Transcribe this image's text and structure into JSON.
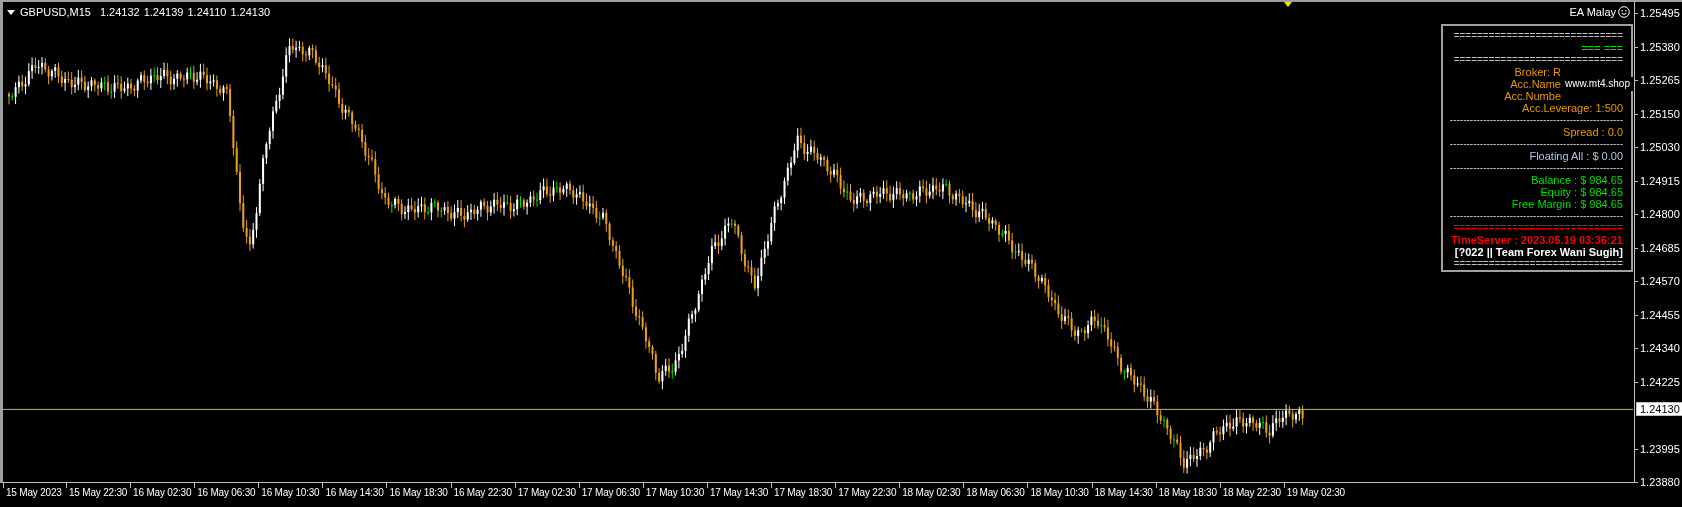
{
  "header": {
    "symbol": "GBPUSD,M15",
    "quotes": [
      "1.24132",
      "1.24139",
      "1.24110",
      "1.24130"
    ]
  },
  "ea_label": "EA Malay",
  "panel": {
    "lines": [
      {
        "kind": "rule",
        "text": "=============================",
        "color": "#c0c0c0"
      },
      {
        "kind": "line",
        "text": "=== ===",
        "color": "#00e000"
      },
      {
        "kind": "rule",
        "text": "=============================",
        "color": "#c0c0c0"
      },
      {
        "kind": "account",
        "text": "Broker: R",
        "color": "#e89a00"
      },
      {
        "kind": "account",
        "text": "Acc.Name",
        "color": "#e89a00"
      },
      {
        "kind": "account",
        "text": "Acc.Numbe",
        "color": "#e89a00"
      },
      {
        "kind": "line",
        "text": "Acc.Leverage: 1:500",
        "color": "#e89a00"
      },
      {
        "kind": "dash",
        "text": "----------------------------------------------------"
      },
      {
        "kind": "line",
        "text": "Spread :  0.0",
        "color": "#e89a00"
      },
      {
        "kind": "dash",
        "text": "----------------------------------------------------"
      },
      {
        "kind": "line",
        "text": "Floating All  : $ 0.00",
        "color": "#b0c4de"
      },
      {
        "kind": "dash",
        "text": "----------------------------------------------------"
      },
      {
        "kind": "line",
        "text": "Balance  : $ 984.65",
        "color": "#00e000"
      },
      {
        "kind": "line",
        "text": "Equity  : $ 984.65",
        "color": "#00e000"
      },
      {
        "kind": "line",
        "text": "Free Margin : $ 984.65",
        "color": "#00e000"
      },
      {
        "kind": "dash",
        "text": "----------------------------------------------------"
      },
      {
        "kind": "rule",
        "text": "=============================",
        "color": "#ff0000"
      },
      {
        "kind": "bold",
        "text": "TimeServer : 2023.05.19 03:36:21",
        "color": "#ff0000"
      },
      {
        "kind": "bold",
        "text": "[?022 || Team Forex Wani Sugih]",
        "color": "#ffffff"
      },
      {
        "kind": "rule",
        "text": "=============================",
        "color": "#c0c0c0"
      }
    ]
  },
  "watermark_label": "www.mt4.shop",
  "price_axis": {
    "labels": [
      "1.25495",
      "1.25380",
      "1.25265",
      "1.25150",
      "1.25030",
      "1.24915",
      "1.24800",
      "1.24685",
      "1.24570",
      "1.24455",
      "1.24340",
      "1.24225",
      "1.23995",
      "1.23880"
    ],
    "current_price": "1.24130"
  },
  "time_axis": {
    "labels": [
      "15 May 2023",
      "15 May 22:30",
      "16 May 02:30",
      "16 May 06:30",
      "16 May 10:30",
      "16 May 14:30",
      "16 May 18:30",
      "16 May 22:30",
      "17 May 02:30",
      "17 May 06:30",
      "17 May 10:30",
      "17 May 14:30",
      "17 May 18:30",
      "17 May 22:30",
      "18 May 02:30",
      "18 May 06:30",
      "18 May 10:30",
      "18 May 14:30",
      "18 May 18:30",
      "18 May 22:30",
      "19 May 02:30"
    ]
  }
}
